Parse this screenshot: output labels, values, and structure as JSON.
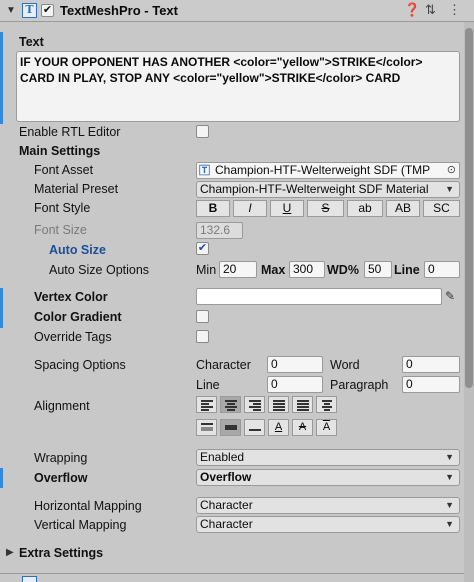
{
  "header": {
    "title": "TextMeshPro - Text",
    "component_icon": "T",
    "help_icon": "help-icon",
    "preset_icon": "preset-icon",
    "more_icon": "more-icon"
  },
  "text_section": {
    "label": "Text",
    "content": "IF YOUR OPPONENT HAS ANOTHER <color=\"yellow\">STRIKE</color>\nCARD IN PLAY, STOP ANY <color=\"yellow\">STRIKE</color> CARD"
  },
  "enable_rtl": {
    "label": "Enable RTL Editor",
    "checked": false
  },
  "main_settings": {
    "label": "Main Settings",
    "font_asset": {
      "label": "Font Asset",
      "value": "Champion-HTF-Welterweight SDF (TMP"
    },
    "material_preset": {
      "label": "Material Preset",
      "value": "Champion-HTF-Welterweight SDF Material"
    },
    "font_style": {
      "label": "Font Style",
      "buttons": [
        "B",
        "I",
        "U",
        "S",
        "ab",
        "AB",
        "SC"
      ]
    },
    "font_size": {
      "label": "Font Size",
      "value": "132.6"
    },
    "auto_size": {
      "label": "Auto Size",
      "checked": true
    },
    "auto_size_options": {
      "label": "Auto Size Options",
      "min_label": "Min",
      "min_value": "20",
      "max_label": "Max",
      "max_value": "300",
      "wd_label": "WD%",
      "wd_value": "50",
      "line_label": "Line",
      "line_value": "0"
    },
    "vertex_color": {
      "label": "Vertex Color",
      "color": "#ffffff"
    },
    "color_gradient": {
      "label": "Color Gradient",
      "checked": false
    },
    "override_tags": {
      "label": "Override Tags",
      "checked": false
    },
    "spacing": {
      "label": "Spacing Options",
      "character_label": "Character",
      "character_value": "0",
      "word_label": "Word",
      "word_value": "0",
      "line_label": "Line",
      "line_value": "0",
      "paragraph_label": "Paragraph",
      "paragraph_value": "0"
    },
    "alignment": {
      "label": "Alignment"
    },
    "wrapping": {
      "label": "Wrapping",
      "value": "Enabled"
    },
    "overflow": {
      "label": "Overflow",
      "value": "Overflow"
    },
    "horizontal_mapping": {
      "label": "Horizontal Mapping",
      "value": "Character"
    },
    "vertical_mapping": {
      "label": "Vertical Mapping",
      "value": "Character"
    }
  },
  "extra_settings": {
    "label": "Extra Settings"
  },
  "colors": {
    "accent": "#2f88d8",
    "blue_label": "#1c4f97",
    "background": "#c8c8c8"
  }
}
